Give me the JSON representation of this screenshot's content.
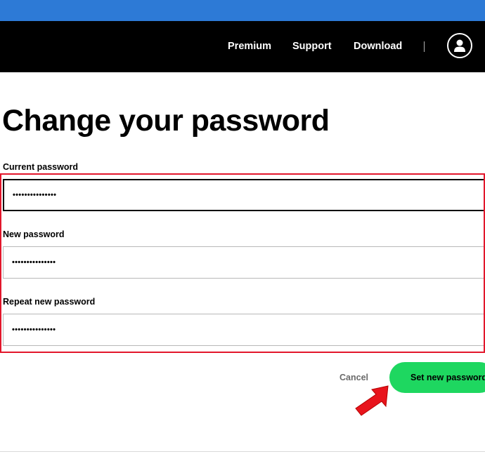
{
  "nav": {
    "links": [
      "Premium",
      "Support",
      "Download"
    ],
    "profile_icon": "user-icon"
  },
  "page": {
    "title": "Change your password"
  },
  "form": {
    "current_password": {
      "label": "Current password",
      "value": "•••••••••••••••"
    },
    "new_password": {
      "label": "New password",
      "value": "•••••••••••••••"
    },
    "repeat_password": {
      "label": "Repeat new password",
      "value": "•••••••••••••••"
    }
  },
  "actions": {
    "cancel_label": "Cancel",
    "submit_label": "Set new password"
  },
  "colors": {
    "nav_background": "#000000",
    "top_strip": "#2d7ad6",
    "accent_green": "#1ed760",
    "highlight_red": "#e2162b"
  }
}
